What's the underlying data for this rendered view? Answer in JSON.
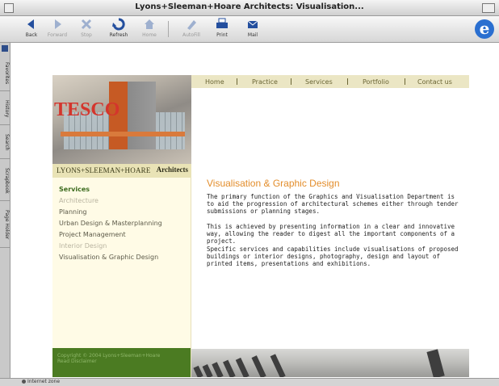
{
  "window": {
    "title": "Lyons+Sleeman+Hoare Architects: Visualisation..."
  },
  "toolbar": {
    "buttons": [
      {
        "label": "Back",
        "icon": "back-arrow-icon",
        "enabled": true
      },
      {
        "label": "Forward",
        "icon": "forward-arrow-icon",
        "enabled": false
      },
      {
        "label": "Stop",
        "icon": "stop-icon",
        "enabled": false
      },
      {
        "label": "Refresh",
        "icon": "refresh-icon",
        "enabled": true
      },
      {
        "label": "Home",
        "icon": "home-icon",
        "enabled": false
      },
      {
        "label": "AutoFill",
        "icon": "autofill-icon",
        "enabled": false
      },
      {
        "label": "Print",
        "icon": "print-icon",
        "enabled": true
      },
      {
        "label": "Mail",
        "icon": "mail-icon",
        "enabled": true
      }
    ],
    "logo_letter": "e"
  },
  "explorer_bar": {
    "tabs": [
      "Favorites",
      "History",
      "Search",
      "Scrapbook",
      "Page Holder"
    ]
  },
  "status_bar": {
    "text": "Internet zone"
  },
  "site": {
    "brand": {
      "name": "LYONS+SLEEMAN+HOARE",
      "suffix": "Architects"
    },
    "hero_sign": "TESCO",
    "nav": [
      "Home",
      "Practice",
      "Services",
      "Portfolio",
      "Contact us"
    ],
    "menu": [
      {
        "label": "Services",
        "state": "active"
      },
      {
        "label": "Architecture",
        "state": "dim"
      },
      {
        "label": "Planning",
        "state": "normal"
      },
      {
        "label": "Urban Design & Masterplanning",
        "state": "normal"
      },
      {
        "label": "Project Management",
        "state": "normal"
      },
      {
        "label": "Interior Design",
        "state": "dim"
      },
      {
        "label": "Visualisation & Graphic Design",
        "state": "normal"
      }
    ],
    "copyright": [
      "Copyright © 2004 Lyons+Sleeman+Hoare",
      "Read Disclaimer"
    ],
    "page": {
      "heading": "Visualisation & Graphic Design",
      "paragraphs": [
        "The primary function of the Graphics and Visualisation Department is to aid the progression of architectural schemes either through tender submissions or planning stages.",
        "This is achieved by presenting information in a clear and innovative way, allowing the reader to digest all the important components of a project.",
        "Specific services and capabilities include visualisations of proposed buildings or interior designs, photography, design and layout of printed items, presentations and exhibitions."
      ]
    }
  },
  "colors": {
    "accent_heading": "#e38d2b",
    "menu_active": "#3c6b1e",
    "nav_bg": "#ebe6c4",
    "footer_green": "#4b7b22"
  }
}
